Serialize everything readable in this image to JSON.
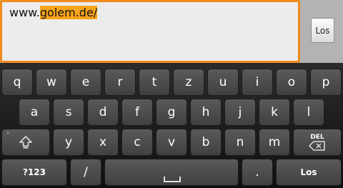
{
  "url_bar": {
    "prefix": "www.",
    "selected": "golem.de/",
    "go_label": "Los"
  },
  "keyboard": {
    "row1": [
      "q",
      "w",
      "e",
      "r",
      "t",
      "z",
      "u",
      "i",
      "o",
      "p"
    ],
    "row2": [
      "a",
      "s",
      "d",
      "f",
      "g",
      "h",
      "j",
      "k",
      "l"
    ],
    "row3": [
      "y",
      "x",
      "c",
      "v",
      "b",
      "n",
      "m"
    ],
    "del_label": "DEL",
    "symbols_label": "?123",
    "slash_label": "/",
    "period_label": ".",
    "go_label": "Los"
  },
  "icons": [
    "shift-icon",
    "backspace-icon",
    "space-icon"
  ],
  "colors": {
    "focus_border": "#f08a1c",
    "selection": "#f7a31b",
    "key_face": "#4c4c4c",
    "keyboard_bg": "#1a1a1a"
  }
}
